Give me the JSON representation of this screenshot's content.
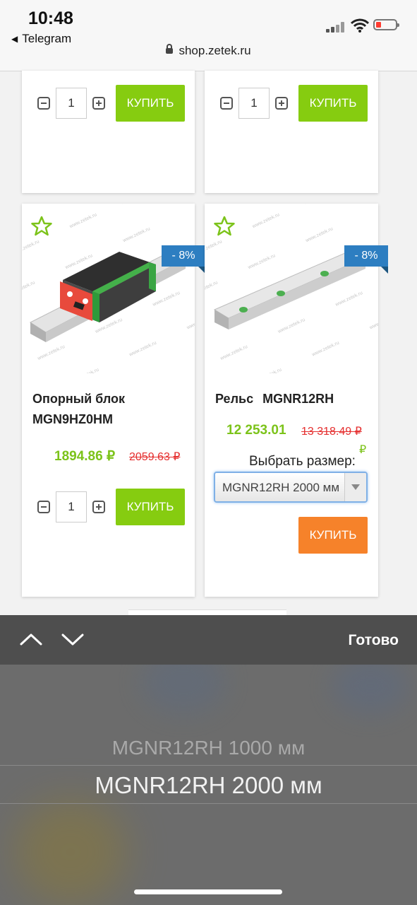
{
  "status": {
    "time": "10:48",
    "back_app": "Telegram"
  },
  "browser": {
    "url": "shop.zetek.ru"
  },
  "top_cards": [
    {
      "qty": "1",
      "buy_label": "КУПИТЬ"
    },
    {
      "qty": "1",
      "buy_label": "КУПИТЬ"
    }
  ],
  "products": [
    {
      "name_line1": "Опорный блок",
      "name_line2": "MGN9HZ0HM",
      "discount": "- 8%",
      "price": "1894.86 ₽",
      "old_price": "2059.63 ₽",
      "qty": "1",
      "buy_label": "КУПИТЬ"
    },
    {
      "name": "Рельс MGNR12RH",
      "discount": "- 8%",
      "price": "12 253.01",
      "old_price": "13 318.49 ₽",
      "price_currency": "₽",
      "size_label": "Выбрать размер:",
      "size_selected": "MGNR12RH 2000 мм",
      "buy_label": "КУПИТЬ"
    }
  ],
  "watermark": "www.zetek.ru",
  "picker": {
    "done_label": "Готово",
    "options": [
      "MGNR12RH 1000 мм",
      "MGNR12RH 2000 мм"
    ],
    "selected_index": 1
  },
  "colors": {
    "buy_green": "#86cc10",
    "buy_orange": "#f6822a",
    "badge_blue": "#2d7ec1",
    "price_green": "#7cc31a",
    "old_price_red": "#e53030"
  },
  "icons": [
    "lock-icon",
    "cellular-signal-icon",
    "wifi-icon",
    "battery-icon",
    "favorite-star-icon",
    "minus-icon",
    "plus-icon",
    "chevron-up-icon",
    "chevron-down-icon",
    "dropdown-arrow-icon"
  ]
}
